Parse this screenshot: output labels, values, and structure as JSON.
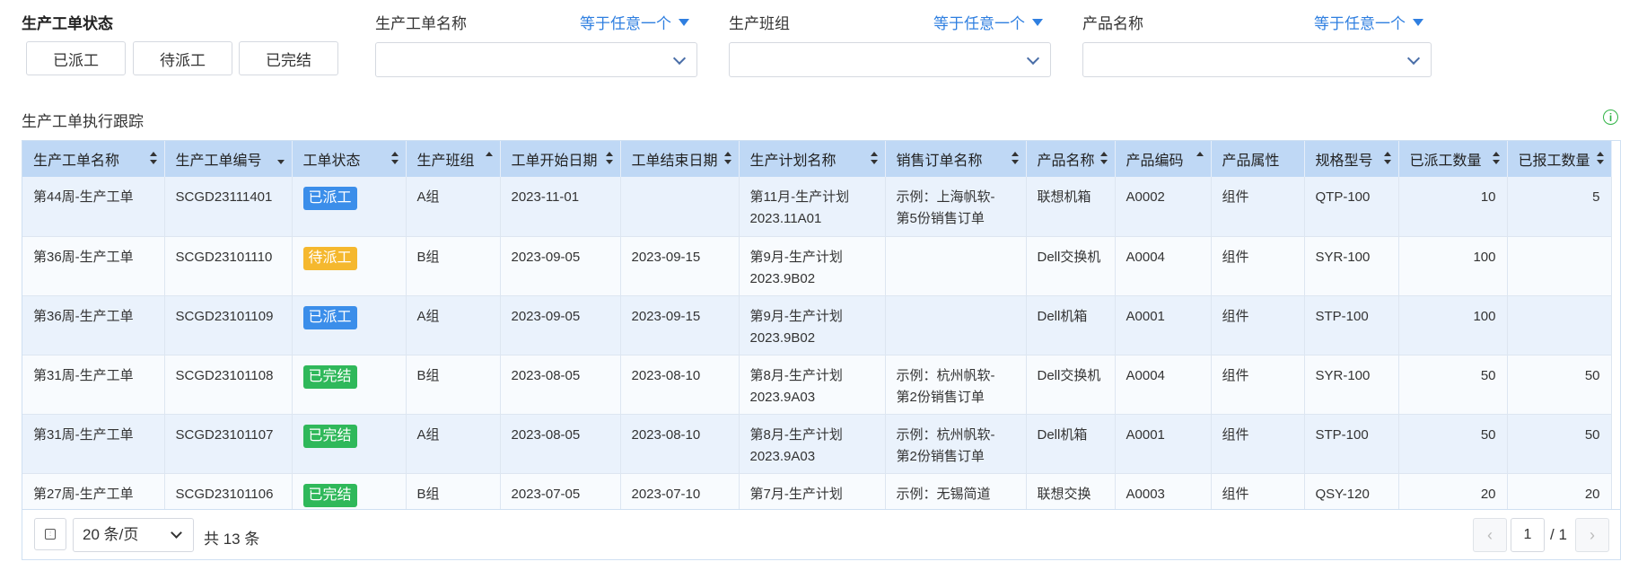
{
  "filters": {
    "status_title": "生产工单状态",
    "status_buttons": [
      "已派工",
      "待派工",
      "已完结"
    ],
    "fields": [
      {
        "label": "生产工单名称",
        "mode": "等于任意一个"
      },
      {
        "label": "生产班组",
        "mode": "等于任意一个"
      },
      {
        "label": "产品名称",
        "mode": "等于任意一个"
      }
    ]
  },
  "section_title": "生产工单执行跟踪",
  "table": {
    "columns": [
      "生产工单名称",
      "生产工单编号",
      "工单状态",
      "生产班组",
      "工单开始日期",
      "工单结束日期",
      "生产计划名称",
      "销售订单名称",
      "产品名称",
      "产品编码",
      "产品属性",
      "规格型号",
      "已派工数量",
      "已报工数量"
    ],
    "rows": [
      {
        "name": "第44周-生产工单",
        "code": "SCGD23111401",
        "status": "已派工",
        "team": "A组",
        "start": "2023-11-01",
        "end": "",
        "plan": [
          "第11月-生产计划",
          "2023.11A01"
        ],
        "order": [
          "示例：上海帆软-",
          "第5份销售订单"
        ],
        "product": "联想机箱",
        "pcode": "A0002",
        "attr": "组件",
        "spec": "QTP-100",
        "dispatched": "10",
        "reported": "5"
      },
      {
        "name": "第36周-生产工单",
        "code": "SCGD23101110",
        "status": "待派工",
        "team": "B组",
        "start": "2023-09-05",
        "end": "2023-09-15",
        "plan": [
          "第9月-生产计划",
          "2023.9B02"
        ],
        "order": [
          "",
          ""
        ],
        "product": "Dell交换机",
        "pcode": "A0004",
        "attr": "组件",
        "spec": "SYR-100",
        "dispatched": "100",
        "reported": ""
      },
      {
        "name": "第36周-生产工单",
        "code": "SCGD23101109",
        "status": "已派工",
        "team": "A组",
        "start": "2023-09-05",
        "end": "2023-09-15",
        "plan": [
          "第9月-生产计划",
          "2023.9B02"
        ],
        "order": [
          "",
          ""
        ],
        "product": "Dell机箱",
        "pcode": "A0001",
        "attr": "组件",
        "spec": "STP-100",
        "dispatched": "100",
        "reported": ""
      },
      {
        "name": "第31周-生产工单",
        "code": "SCGD23101108",
        "status": "已完结",
        "team": "B组",
        "start": "2023-08-05",
        "end": "2023-08-10",
        "plan": [
          "第8月-生产计划",
          "2023.9A03"
        ],
        "order": [
          "示例：杭州帆软-",
          "第2份销售订单"
        ],
        "product": "Dell交换机",
        "pcode": "A0004",
        "attr": "组件",
        "spec": "SYR-100",
        "dispatched": "50",
        "reported": "50"
      },
      {
        "name": "第31周-生产工单",
        "code": "SCGD23101107",
        "status": "已完结",
        "team": "A组",
        "start": "2023-08-05",
        "end": "2023-08-10",
        "plan": [
          "第8月-生产计划",
          "2023.9A03"
        ],
        "order": [
          "示例：杭州帆软-",
          "第2份销售订单"
        ],
        "product": "Dell机箱",
        "pcode": "A0001",
        "attr": "组件",
        "spec": "STP-100",
        "dispatched": "50",
        "reported": "50"
      },
      {
        "name": "第27周-生产工单",
        "code": "SCGD23101106",
        "status": "已完结",
        "team": "B组",
        "start": "2023-07-05",
        "end": "2023-07-10",
        "plan": [
          "第7月-生产计划",
          ""
        ],
        "order": [
          "示例：无锡简道",
          ""
        ],
        "product": "联想交换",
        "pcode": "A0003",
        "attr": "组件",
        "spec": "QSY-120",
        "dispatched": "20",
        "reported": "20"
      }
    ]
  },
  "status_colors": {
    "已派工": "#3b8eea",
    "待派工": "#f5b82e",
    "已完结": "#2fb85a"
  },
  "pagination": {
    "page_size": "20 条/页",
    "total": "共 13 条",
    "current": "1",
    "of_total": "/ 1",
    "prev": "‹",
    "next": "›"
  }
}
